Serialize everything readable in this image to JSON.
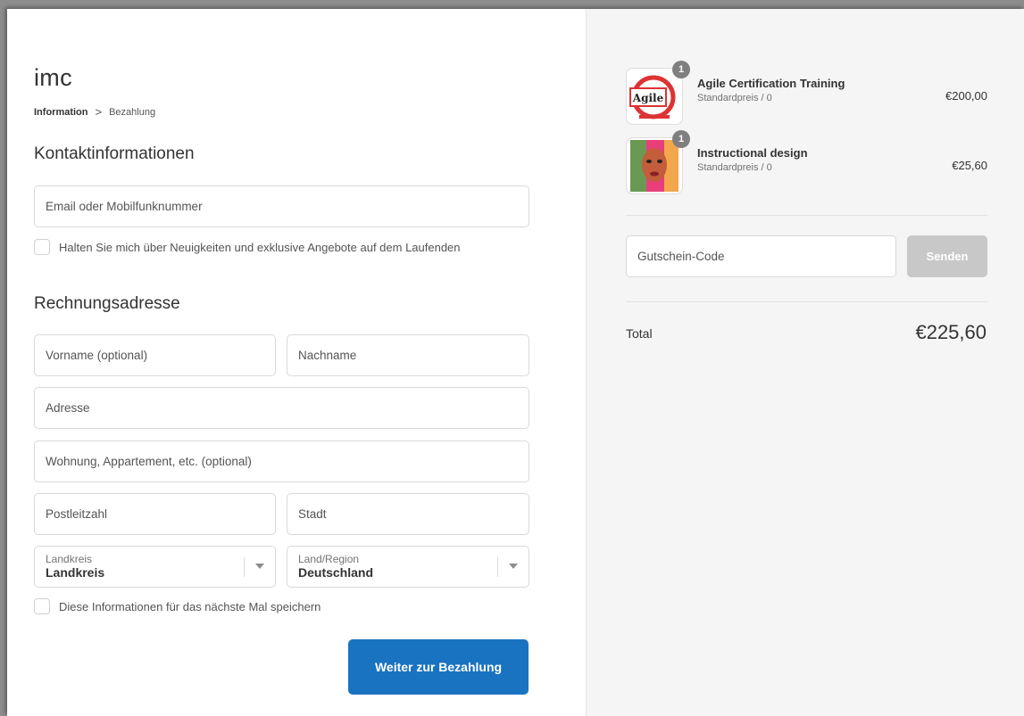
{
  "brand": "imc",
  "breadcrumb": {
    "step1": "Information",
    "separator": ">",
    "step2": "Bezahlung"
  },
  "contact": {
    "title": "Kontaktinformationen",
    "email_placeholder": "Email oder Mobilfunknummer",
    "newsletter_label": "Halten Sie mich über Neuigkeiten und exklusive Angebote auf dem Laufenden"
  },
  "billing": {
    "title": "Rechnungsadresse",
    "first_name_placeholder": "Vorname (optional)",
    "last_name_placeholder": "Nachname",
    "address_placeholder": "Adresse",
    "apartment_placeholder": "Wohnung, Appartement, etc. (optional)",
    "postal_placeholder": "Postleitzahl",
    "city_placeholder": "Stadt",
    "county_label": "Landkreis",
    "county_value": "Landkreis",
    "country_label": "Land/Region",
    "country_value": "Deutschland",
    "save_info_label": "Diese Informationen für das nächste Mal speichern",
    "continue_label": "Weiter zur Bezahlung"
  },
  "cart": {
    "items": [
      {
        "name": "Agile Certification Training",
        "sub": "Standardpreis / 0",
        "price": "€200,00",
        "qty": "1",
        "thumb_text": "Agile"
      },
      {
        "name": "Instructional design",
        "sub": "Standardpreis / 0",
        "price": "€25,60",
        "qty": "1"
      }
    ],
    "coupon_placeholder": "Gutschein-Code",
    "coupon_button": "Senden",
    "total_label": "Total",
    "total_value": "€225,60"
  },
  "colors": {
    "primary": "#1a73c1",
    "disabled": "#c8c8c8",
    "badge": "#7f7f7f"
  }
}
